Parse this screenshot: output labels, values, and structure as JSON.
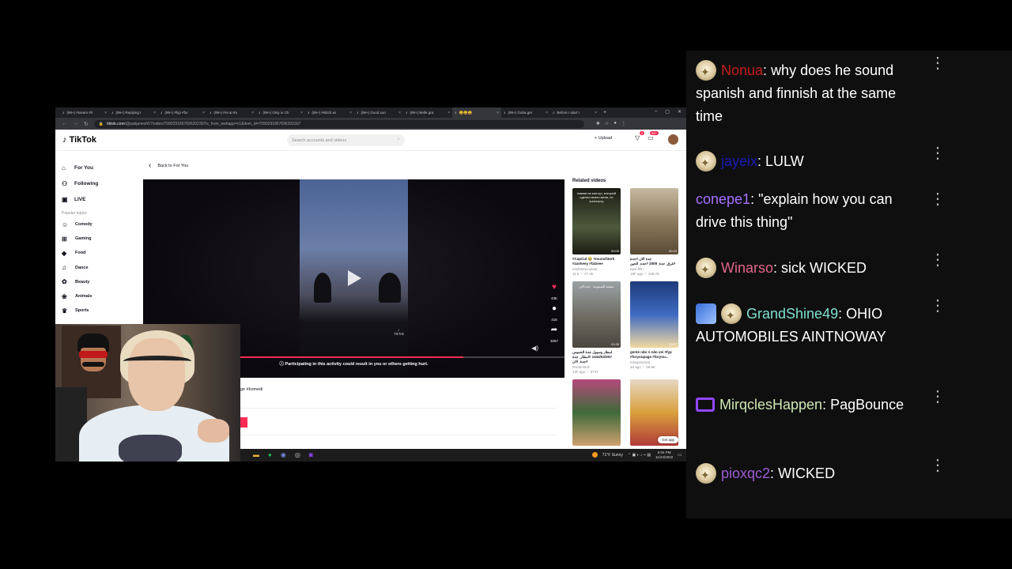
{
  "browser": {
    "tabs": [
      "(99+) #xteam #li",
      "(99+) Replying t",
      "(99+) #fyp #for",
      "(99+) Fet & Ro",
      "(99+) Only in Ch",
      "(99+) #stitch wi",
      "(99+) Good sun",
      "(99+) Belle gra",
      "",
      "(99+) Gotta get",
      "Before I start I"
    ],
    "url_host": "tiktok.com",
    "url_path": "/@pabjanesh57/video/7090291867696202307is_from_webapp=v1&item_id=7090291867696202307"
  },
  "tiktok": {
    "logo": "TikTok",
    "search_placeholder": "Search accounts and videos",
    "upload": "Upload",
    "inbox_badge": "99+",
    "nav": [
      {
        "label": "For You",
        "icon": "home-icon"
      },
      {
        "label": "Following",
        "icon": "people-icon"
      },
      {
        "label": "LIVE",
        "icon": "live-icon"
      }
    ],
    "popular_topics_title": "Popular topics",
    "topics": [
      {
        "label": "Comedy",
        "icon": "smile-icon"
      },
      {
        "label": "Gaming",
        "icon": "gamepad-icon"
      },
      {
        "label": "Food",
        "icon": "food-icon"
      },
      {
        "label": "Dance",
        "icon": "dance-icon"
      },
      {
        "label": "Beauty",
        "icon": "beauty-icon"
      },
      {
        "label": "Animals",
        "icon": "paw-icon"
      },
      {
        "label": "Sports",
        "icon": "trophy-icon"
      }
    ],
    "back_label": "Back to For You",
    "video": {
      "likes": "43K",
      "comments": "415",
      "shares": "3267",
      "watermark": "TikTok",
      "warning": "Participating in this activity could result in you or others getting hurt.",
      "progress": 0.76
    },
    "caption_tail": "ge #komedi",
    "related_title": "Related videos",
    "related": [
      {
        "overlay": "нажми на кап-кут, который сделал моего меня, по контексту",
        "duration": "00:05",
        "desc": "#CapCut 😂 #munsif4erk #zasheey #falzeee",
        "author": "zasheery.russia",
        "meta": "11:5  ♡ 27.4K",
        "bg": "linear-gradient(#1b1b14, #4e5a3c 60%, #1a1a12)"
      },
      {
        "overlay": "",
        "duration": "00:10",
        "desc": "جدة الان #جدة #غرق_جدة_2009 #جده_الحين",
        "author": "epsi.fkfn",
        "meta": "18h ago  ♡ 108.7K",
        "bg": "linear-gradient(#c7b9a2, #8c7a5c 50%, #5a4a36)"
      },
      {
        "overlay": "صفحة السعودية · جدة الان",
        "duration": "01:28",
        "desc": "امطار وسيول جدة الخميس #1444/04/30 #امطار_جدة #جدة_الان",
        "author": "#m3unlock",
        "meta": "12h ago  ♡ 3747",
        "bg": "linear-gradient(#9aa3a6, #6d6a60 55%, #4b4640)"
      },
      {
        "overlay": "",
        "duration": "00:07",
        "desc": "gente não ri não vei #fyp #foryoupage #foryou...",
        "author": "mtogomama",
        "meta": "4d ago  ♡ 58.8K",
        "bg": "linear-gradient(#1e3a7a, #3f6bc2 50%, #f1d9a0)"
      },
      {
        "overlay": "",
        "duration": "",
        "desc": "",
        "author": "",
        "meta": "",
        "bg": "linear-gradient(#b44a7a, #3e6a3a 50%, #d0a070)"
      },
      {
        "overlay": "",
        "duration": "",
        "desc": "",
        "author": "",
        "meta": "",
        "bg": "linear-gradient(#e7d8c4, #d9a03c 50%, #b03a3a)"
      }
    ],
    "get_app": "Get app"
  },
  "taskbar": {
    "weather": "71°F  Sunny",
    "time": "5:04 PM",
    "date": "11/24/2022"
  },
  "chat": {
    "messages": [
      {
        "user": "Nonua",
        "color": "#c41e1e",
        "text": "why does he sound spanish and finnish at the same time",
        "badges": [
          "star"
        ]
      },
      {
        "user": "jayeix",
        "color": "#1a1ab8",
        "text": "LULW",
        "badges": [
          "star"
        ]
      },
      {
        "user": "conepe1",
        "color": "#a970ff",
        "text": "\"explain how you can drive this thing\"",
        "badges": []
      },
      {
        "user": "Winarso",
        "color": "#e0668a",
        "text": "sick WICKED",
        "badges": [
          "star"
        ]
      },
      {
        "user": "GrandShine49",
        "color": "#7fe0d0",
        "text": "OHIO AUTOMOBILES AINTNOWAY",
        "badges": [
          "prime",
          "star"
        ]
      },
      {
        "user": "MirqclesHappen",
        "color": "#cde8b4",
        "text": "PagBounce",
        "badges": [
          "bot"
        ]
      },
      {
        "user": "pioxqc2",
        "color": "#9d5cd6",
        "text": "WICKED",
        "badges": [
          "star"
        ]
      }
    ]
  }
}
